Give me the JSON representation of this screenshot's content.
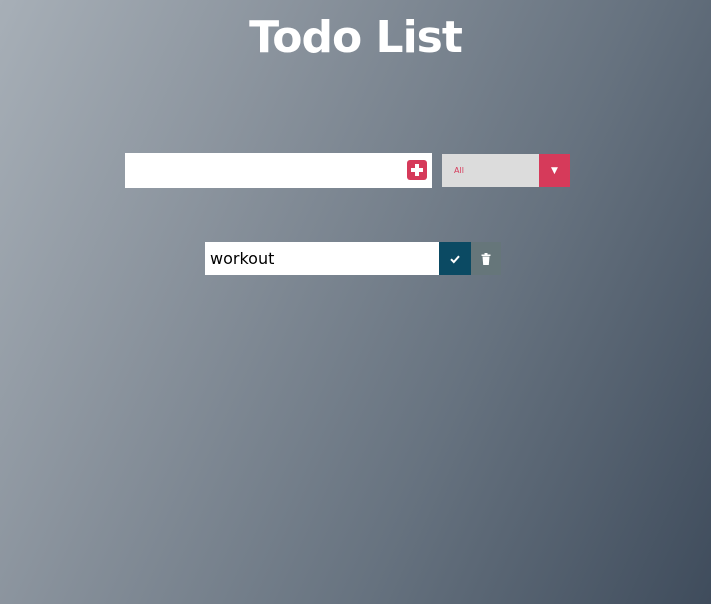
{
  "header": {
    "title": "Todo List"
  },
  "form": {
    "input_value": "",
    "add_icon": "plus-square-icon",
    "filter": {
      "selected": "All",
      "arrow": "▼"
    }
  },
  "todos": [
    {
      "text": "workout",
      "complete_icon": "check-icon",
      "trash_icon": "trash-icon"
    }
  ],
  "colors": {
    "accent": "#d63a5a",
    "complete": "#0b4a63",
    "trash": "#66767a",
    "gradient_start": "#a7afb7",
    "gradient_end": "#3f4c5c"
  }
}
